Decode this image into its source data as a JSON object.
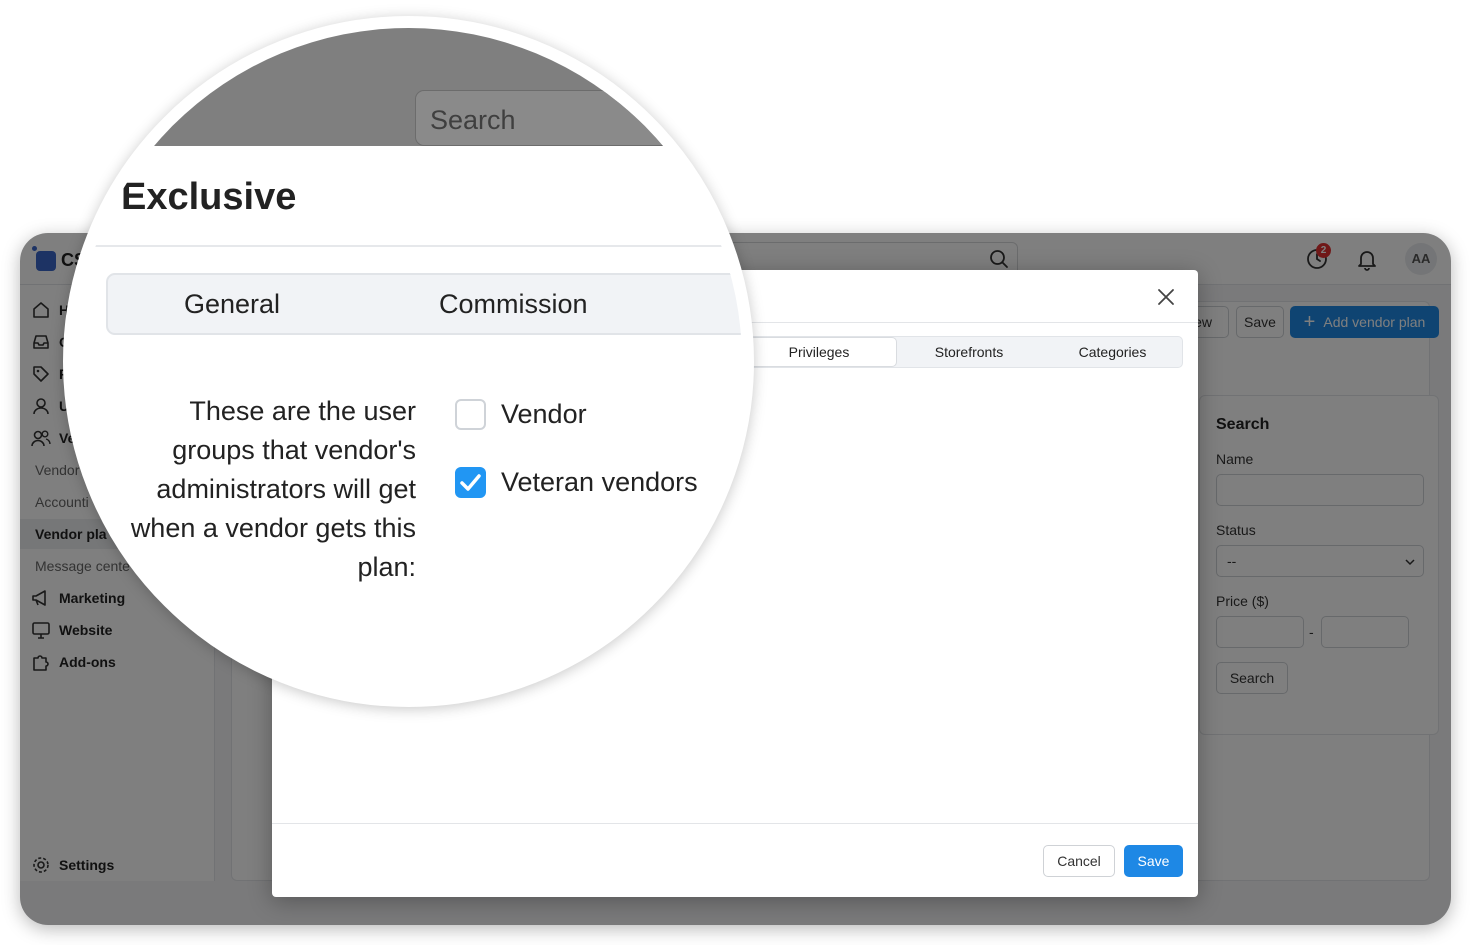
{
  "app": {
    "logo_text": "CS",
    "notification_badge": "2",
    "avatar_initials": "AA"
  },
  "sidebar": {
    "items": [
      {
        "label": "H",
        "icon": "home-icon"
      },
      {
        "label": "O",
        "icon": "inbox-icon"
      },
      {
        "label": "P",
        "icon": "tag-icon"
      },
      {
        "label": "U",
        "icon": "user-icon"
      },
      {
        "label": "Ve",
        "icon": "users-icon"
      }
    ],
    "sub_items": [
      "Vendor",
      "Accounti",
      "Vendor pla",
      "Message cente"
    ],
    "active_sub": "Vendor pla",
    "bottom_items": [
      {
        "label": "Marketing",
        "icon": "megaphone-icon"
      },
      {
        "label": "Website",
        "icon": "monitor-icon"
      },
      {
        "label": "Add-ons",
        "icon": "puzzle-icon"
      }
    ],
    "settings_label": "Settings"
  },
  "toolbar": {
    "view_label": "iew",
    "save_label": "Save",
    "add_label": "Add vendor plan"
  },
  "search_panel": {
    "title": "Search",
    "name_label": "Name",
    "status_label": "Status",
    "status_value": "--",
    "price_label": "Price ($)",
    "range_sep": "-",
    "button_label": "Search"
  },
  "modal": {
    "tabs": [
      "Privileges",
      "Storefronts",
      "Categories"
    ],
    "active_tab": "Privileges",
    "cancel_label": "Cancel",
    "save_label": "Save"
  },
  "magnifier": {
    "search_placeholder": "Search",
    "title": "Exclusive",
    "tabs": [
      "General",
      "Commission"
    ],
    "description": "These are the user groups that vendor's administrators will get when a vendor gets this plan:",
    "checkboxes": [
      {
        "label": "Vendor",
        "checked": false
      },
      {
        "label": "Veteran vendors",
        "checked": true
      }
    ]
  },
  "colors": {
    "primary": "#1e88e5",
    "checkbox_on": "#2196f3",
    "badge": "#e03131"
  }
}
